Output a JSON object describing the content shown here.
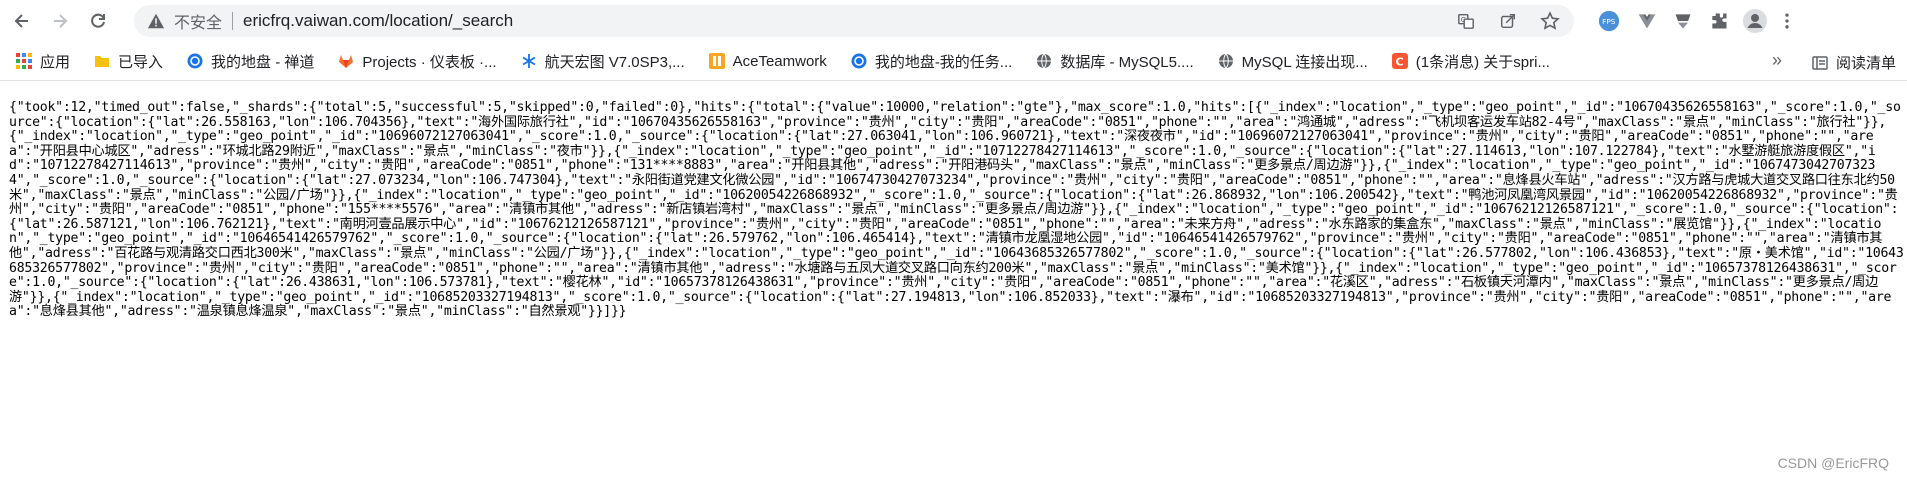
{
  "browser": {
    "insecure_label": "不安全",
    "url": "ericfrq.vaiwan.com/location/_search"
  },
  "bookmarks": {
    "apps_label": "应用",
    "items": [
      {
        "label": "已导入",
        "icon": "folder-icon"
      },
      {
        "label": "我的地盘 - 禅道",
        "icon": "zentao-icon"
      },
      {
        "label": "Projects · 仪表板 ·...",
        "icon": "gitlab-icon"
      },
      {
        "label": "航天宏图 V7.0SP3,...",
        "icon": "snowflake-icon"
      },
      {
        "label": "AceTeamwork",
        "icon": "aceteamwork-icon"
      },
      {
        "label": "我的地盘-我的任务...",
        "icon": "zentao-icon"
      },
      {
        "label": "数据库 - MySQL5....",
        "icon": "globe-icon"
      },
      {
        "label": "MySQL 连接出现...",
        "icon": "globe-icon"
      },
      {
        "label": "(1条消息) 关于spri...",
        "icon": "csdn-icon"
      }
    ],
    "more_label": "»",
    "reading_list_label": "阅读清单"
  },
  "json_response": "{\"took\":12,\"timed_out\":false,\"_shards\":{\"total\":5,\"successful\":5,\"skipped\":0,\"failed\":0},\"hits\":{\"total\":{\"value\":10000,\"relation\":\"gte\"},\"max_score\":1.0,\"hits\":[{\"_index\":\"location\",\"_type\":\"geo_point\",\"_id\":\"10670435626558163\",\"_score\":1.0,\"_source\":{\"location\":{\"lat\":26.558163,\"lon\":106.704356},\"text\":\"海外国际旅行社\",\"id\":\"10670435626558163\",\"province\":\"贵州\",\"city\":\"贵阳\",\"areaCode\":\"0851\",\"phone\":\"\",\"area\":\"鸿通城\",\"adress\":\"飞机坝客运发车站82-4号\",\"maxClass\":\"景点\",\"minClass\":\"旅行社\"}},{\"_index\":\"location\",\"_type\":\"geo_point\",\"_id\":\"10696072127063041\",\"_score\":1.0,\"_source\":{\"location\":{\"lat\":27.063041,\"lon\":106.960721},\"text\":\"深夜夜市\",\"id\":\"10696072127063041\",\"province\":\"贵州\",\"city\":\"贵阳\",\"areaCode\":\"0851\",\"phone\":\"\",\"area\":\"开阳县中心城区\",\"adress\":\"环城北路29附近\",\"maxClass\":\"景点\",\"minClass\":\"夜市\"}},{\"_index\":\"location\",\"_type\":\"geo_point\",\"_id\":\"10712278427114613\",\"_score\":1.0,\"_source\":{\"location\":{\"lat\":27.114613,\"lon\":107.122784},\"text\":\"水墅游艇旅游度假区\",\"id\":\"10712278427114613\",\"province\":\"贵州\",\"city\":\"贵阳\",\"areaCode\":\"0851\",\"phone\":\"131****8883\",\"area\":\"开阳县其他\",\"adress\":\"开阳港码头\",\"maxClass\":\"景点\",\"minClass\":\"更多景点/周边游\"}},{\"_index\":\"location\",\"_type\":\"geo_point\",\"_id\":\"10674730427073234\",\"_score\":1.0,\"_source\":{\"location\":{\"lat\":27.073234,\"lon\":106.747304},\"text\":\"永阳街道党建文化微公园\",\"id\":\"10674730427073234\",\"province\":\"贵州\",\"city\":\"贵阳\",\"areaCode\":\"0851\",\"phone\":\"\",\"area\":\"息烽县火车站\",\"adress\":\"汉方路与虎城大道交叉路口往东北约50米\",\"maxClass\":\"景点\",\"minClass\":\"公园/广场\"}},{\"_index\":\"location\",\"_type\":\"geo_point\",\"_id\":\"10620054226868932\",\"_score\":1.0,\"_source\":{\"location\":{\"lat\":26.868932,\"lon\":106.200542},\"text\":\"鸭池河凤凰湾风景园\",\"id\":\"10620054226868932\",\"province\":\"贵州\",\"city\":\"贵阳\",\"areaCode\":\"0851\",\"phone\":\"155****5576\",\"area\":\"清镇市其他\",\"adress\":\"新店镇岩湾村\",\"maxClass\":\"景点\",\"minClass\":\"更多景点/周边游\"}},{\"_index\":\"location\",\"_type\":\"geo_point\",\"_id\":\"10676212126587121\",\"_score\":1.0,\"_source\":{\"location\":{\"lat\":26.587121,\"lon\":106.762121},\"text\":\"南明河壹品展示中心\",\"id\":\"10676212126587121\",\"province\":\"贵州\",\"city\":\"贵阳\",\"areaCode\":\"0851\",\"phone\":\"\",\"area\":\"未来方舟\",\"adress\":\"水东路家的集盒东\",\"maxClass\":\"景点\",\"minClass\":\"展览馆\"}},{\"_index\":\"location\",\"_type\":\"geo_point\",\"_id\":\"10646541426579762\",\"_score\":1.0,\"_source\":{\"location\":{\"lat\":26.579762,\"lon\":106.465414},\"text\":\"清镇市龙凰湿地公园\",\"id\":\"10646541426579762\",\"province\":\"贵州\",\"city\":\"贵阳\",\"areaCode\":\"0851\",\"phone\":\"\",\"area\":\"清镇市其他\",\"adress\":\"百花路与观清路交口西北300米\",\"maxClass\":\"景点\",\"minClass\":\"公园/广场\"}},{\"_index\":\"location\",\"_type\":\"geo_point\",\"_id\":\"10643685326577802\",\"_score\":1.0,\"_source\":{\"location\":{\"lat\":26.577802,\"lon\":106.436853},\"text\":\"原・美术馆\",\"id\":\"10643685326577802\",\"province\":\"贵州\",\"city\":\"贵阳\",\"areaCode\":\"0851\",\"phone\":\"\",\"area\":\"清镇市其他\",\"adress\":\"水塘路与五凤大道交叉路口向东约200米\",\"maxClass\":\"景点\",\"minClass\":\"美术馆\"}},{\"_index\":\"location\",\"_type\":\"geo_point\",\"_id\":\"10657378126438631\",\"_score\":1.0,\"_source\":{\"location\":{\"lat\":26.438631,\"lon\":106.573781},\"text\":\"樱花林\",\"id\":\"10657378126438631\",\"province\":\"贵州\",\"city\":\"贵阳\",\"areaCode\":\"0851\",\"phone\":\"\",\"area\":\"花溪区\",\"adress\":\"石板镇天河潭内\",\"maxClass\":\"景点\",\"minClass\":\"更多景点/周边游\"}},{\"_index\":\"location\",\"_type\":\"geo_point\",\"_id\":\"10685203327194813\",\"_score\":1.0,\"_source\":{\"location\":{\"lat\":27.194813,\"lon\":106.852033},\"text\":\"瀑布\",\"id\":\"10685203327194813\",\"province\":\"贵州\",\"city\":\"贵阳\",\"areaCode\":\"0851\",\"phone\":\"\",\"area\":\"息烽县其他\",\"adress\":\"温泉镇息烽温泉\",\"maxClass\":\"景点\",\"minClass\":\"自然景观\"}}]}}",
  "watermark": "CSDN @EricFRQ"
}
